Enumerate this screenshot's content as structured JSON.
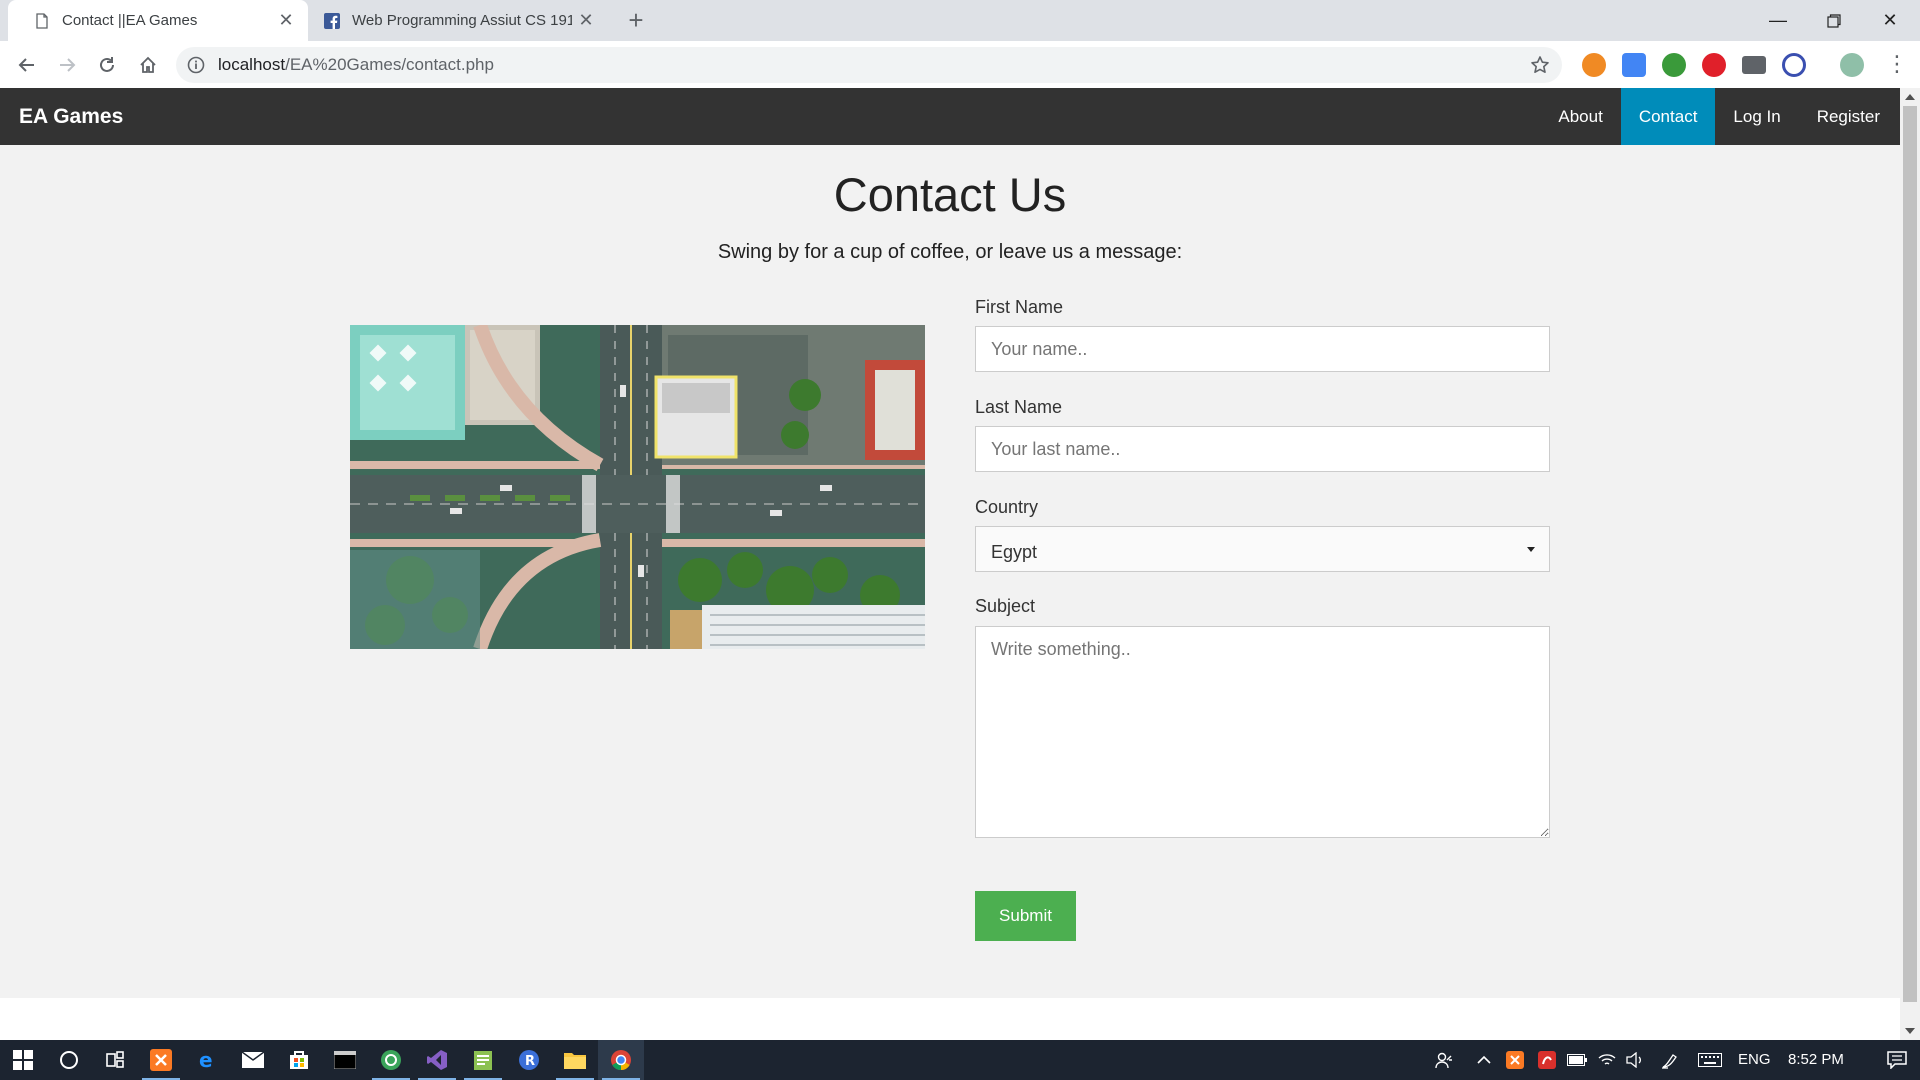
{
  "browser": {
    "tabs": [
      {
        "title": "Contact ||EA Games",
        "icon": "page-icon",
        "active": true
      },
      {
        "title": "Web Programming Assiut CS 191",
        "icon": "facebook-icon",
        "active": false
      }
    ],
    "address": {
      "host": "localhost",
      "path": "/EA%20Games/contact.php"
    }
  },
  "site": {
    "brand": "EA Games",
    "nav": [
      {
        "label": "About",
        "active": false
      },
      {
        "label": "Contact",
        "active": true
      },
      {
        "label": "Log In",
        "active": false
      },
      {
        "label": "Register",
        "active": false
      }
    ]
  },
  "page": {
    "title": "Contact Us",
    "subtitle": "Swing by for a cup of coffee, or leave us a message:",
    "photo": "aerial-city-intersection-photo"
  },
  "form": {
    "first_name": {
      "label": "First Name",
      "placeholder": "Your name.."
    },
    "last_name": {
      "label": "Last Name",
      "placeholder": "Your last name.."
    },
    "country": {
      "label": "Country",
      "selected": "Egypt"
    },
    "subject": {
      "label": "Subject",
      "placeholder": "Write something.."
    },
    "submit_label": "Submit"
  },
  "taskbar": {
    "language": "ENG",
    "time": "8:52 PM"
  },
  "colors": {
    "navbar": "#333333",
    "nav_active": "#008cba",
    "submit": "#4caf50",
    "content_bg": "#f2f2f2"
  }
}
